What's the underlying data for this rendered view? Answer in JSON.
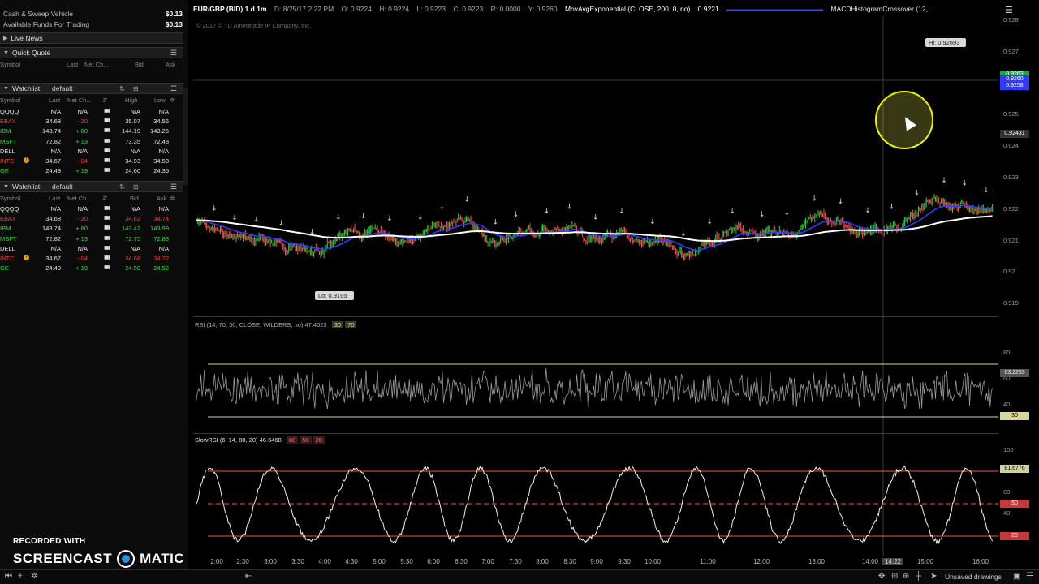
{
  "account": {
    "rows": [
      {
        "label": "Cash & Sweep Vehicle",
        "value": "$0.13"
      },
      {
        "label": "Available Funds For Trading",
        "value": "$0.13"
      }
    ]
  },
  "sections": {
    "live_news": "Live News",
    "quick_quote": "Quick Quote",
    "quick_quote_cols": [
      "Symbol",
      "Last",
      "Net Ch...",
      "Bid",
      "Ask"
    ]
  },
  "watchlists": [
    {
      "title": "Watchlist",
      "name": "default",
      "cols": [
        "Symbol",
        "Last",
        "Net Ch...",
        "High",
        "Low"
      ],
      "rows": [
        {
          "symbol": "QQQQ",
          "last": "N/A",
          "net": "N/A",
          "a": "N/A",
          "b": "N/A",
          "color": "wht",
          "alert": false
        },
        {
          "symbol": "EBAY",
          "last": "34.68",
          "net": "-.20",
          "a": "35.07",
          "b": "34.56",
          "color": "red",
          "alert": false
        },
        {
          "symbol": "IBM",
          "last": "143.74",
          "net": "+.80",
          "a": "144.19",
          "b": "143.25",
          "color": "grn",
          "alert": false
        },
        {
          "symbol": "MSFT",
          "last": "72.82",
          "net": "+.13",
          "a": "73.35",
          "b": "72.48",
          "color": "grn",
          "alert": false
        },
        {
          "symbol": "DELL",
          "last": "N/A",
          "net": "N/A",
          "a": "N/A",
          "b": "N/A",
          "color": "wht",
          "alert": false
        },
        {
          "symbol": "INTC",
          "last": "34.67",
          "net": "-.04",
          "a": "34.93",
          "b": "34.58",
          "color": "red",
          "alert": true
        },
        {
          "symbol": "GE",
          "last": "24.49",
          "net": "+.19",
          "a": "24.60",
          "b": "24.35",
          "color": "grn",
          "alert": false
        }
      ]
    },
    {
      "title": "Watchlist",
      "name": "default",
      "cols": [
        "Symbol",
        "Last",
        "Net Ch...",
        "Bid",
        "Ask"
      ],
      "rows": [
        {
          "symbol": "QQQQ",
          "last": "N/A",
          "net": "N/A",
          "a": "N/A",
          "b": "N/A",
          "color": "wht",
          "alert": false
        },
        {
          "symbol": "EBAY",
          "last": "34.68",
          "net": "-.20",
          "a": "34.62",
          "b": "34.74",
          "color": "red",
          "alert": false
        },
        {
          "symbol": "IBM",
          "last": "143.74",
          "net": "+.80",
          "a": "143.42",
          "b": "143.99",
          "color": "grn",
          "alert": false
        },
        {
          "symbol": "MSFT",
          "last": "72.82",
          "net": "+.13",
          "a": "72.75",
          "b": "72.83",
          "color": "grn",
          "alert": false
        },
        {
          "symbol": "DELL",
          "last": "N/A",
          "net": "N/A",
          "a": "N/A",
          "b": "N/A",
          "color": "wht",
          "alert": false
        },
        {
          "symbol": "INTC",
          "last": "34.67",
          "net": "-.04",
          "a": "34.68",
          "b": "34.72",
          "color": "red",
          "alert": true
        },
        {
          "symbol": "GE",
          "last": "24.49",
          "net": "+.19",
          "a": "24.50",
          "b": "24.52",
          "color": "grn",
          "alert": false
        }
      ]
    }
  ],
  "watermark": {
    "line1": "RECORDED WITH",
    "line2a": "SCREENCAST",
    "line2b": "MATIC"
  },
  "chart_header": {
    "symbol": "EUR/GBP (BID) 1 d 1m",
    "date": "D: 8/25/17 2:22 PM",
    "open": "O: 0.9224",
    "high": "H: 0.9224",
    "low": "L: 0.9223",
    "close": "C: 0.9223",
    "r": "R: 0.0000",
    "y": "Y: 0.9260",
    "ma_study": "MovAvgExponential (CLOSE, 200, 0, no)",
    "ma_value": "0.9221",
    "macd_study": "MACDHistogramCrossover (12,...",
    "copyright": "© 2017 © TD Ameritrade IP Company, Inc."
  },
  "price_panel": {
    "hi_label": "Hi: 0.92693",
    "lo_label": "Lo: 0.9195",
    "ticks": [
      "0.928",
      "0.927",
      "0.926",
      "0.925",
      "0.924",
      "0.923",
      "0.922",
      "0.921",
      "0.92",
      "0.919"
    ],
    "tags": [
      {
        "text": "0.9263",
        "color": "#1aa64a"
      },
      {
        "text": "0.9260",
        "color": "#2f3cff"
      },
      {
        "text": "0.9258",
        "color": "#2f3cff"
      },
      {
        "text": "0.92431",
        "color": "#333333"
      }
    ]
  },
  "rsi_panel": {
    "title": "RSI (14, 70, 30, CLOSE, WILDERS, no)",
    "value": "47.4023",
    "tag1": "30",
    "tag2": "70",
    "ticks": [
      "80",
      "60",
      "40"
    ],
    "tag_value": "63.2253",
    "tag_level": "30"
  },
  "srsi_panel": {
    "title": "SlowRSI (6, 14, 80, 20)",
    "value": "46.6468",
    "tag1": "80",
    "tag2": "50",
    "tag3": "20",
    "ticks": [
      "100",
      "60",
      "40"
    ],
    "tag_value": "81.6776",
    "tag_50": "50",
    "tag_20": "20"
  },
  "time_axis": {
    "labels": [
      "2:00",
      "2:30",
      "3:00",
      "3:30",
      "4:00",
      "4:30",
      "5:00",
      "5:30",
      "6:00",
      "6:30",
      "7:00",
      "7:30",
      "8:00",
      "8:30",
      "9:00",
      "9:30",
      "10:00",
      "11:00",
      "12:00",
      "13:00",
      "14:00",
      "14:22",
      "15:00",
      "16:00"
    ]
  },
  "status": {
    "unsaved": "Unsaved drawings"
  },
  "colors": {
    "ema": "#ffffff",
    "fast_ma": "#2f3cff",
    "up_candle": "#2ecc40",
    "down_candle": "#ff4d4d",
    "rsi_line": "#9a9a9a",
    "srsi_line": "#f5f5c8",
    "level_line": "#d7d79a",
    "srsi_level": "#ff4d4d"
  }
}
